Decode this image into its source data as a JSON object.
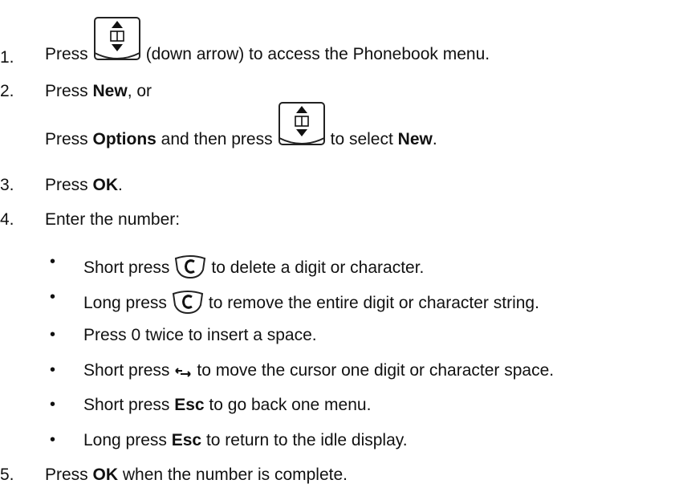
{
  "steps": [
    {
      "num": "1.",
      "pre": "Press",
      "post": "(down arrow) to access the Phonebook menu.",
      "icon": "phonebook-nav-key-icon"
    },
    {
      "num": "2.",
      "pre": "Press ",
      "bold": "New",
      "post": ", or"
    },
    {
      "pre": "Press ",
      "bold1": "Options",
      "mid": " and then press",
      "post": "to select ",
      "bold2": "New",
      "end": ".",
      "icon": "phonebook-nav-key-icon"
    },
    {
      "num": "3.",
      "pre": "Press ",
      "bold": "OK",
      "post": "."
    },
    {
      "num": "4.",
      "text": "Enter the number:"
    },
    {
      "num": "5.",
      "pre": "Press ",
      "bold": "OK",
      "post": " when the number is complete."
    }
  ],
  "bullets": [
    {
      "pre": "Short press",
      "post": "to delete a digit or character.",
      "icon": "clear-key-icon"
    },
    {
      "pre": "Long press",
      "post": "to remove the entire digit or character string.",
      "icon": "clear-key-icon"
    },
    {
      "text": "Press 0 twice to insert a space."
    },
    {
      "pre": "Short press",
      "post": "to move the cursor one digit or character space.",
      "icon": "cursor-arrow-icon",
      "glyph": "↤↦"
    },
    {
      "pre": "Short press ",
      "bold": "Esc",
      "post": " to go back one menu."
    },
    {
      "pre": "Long press ",
      "bold": "Esc",
      "post": " to return to the idle display."
    }
  ],
  "bullet_char": "•"
}
